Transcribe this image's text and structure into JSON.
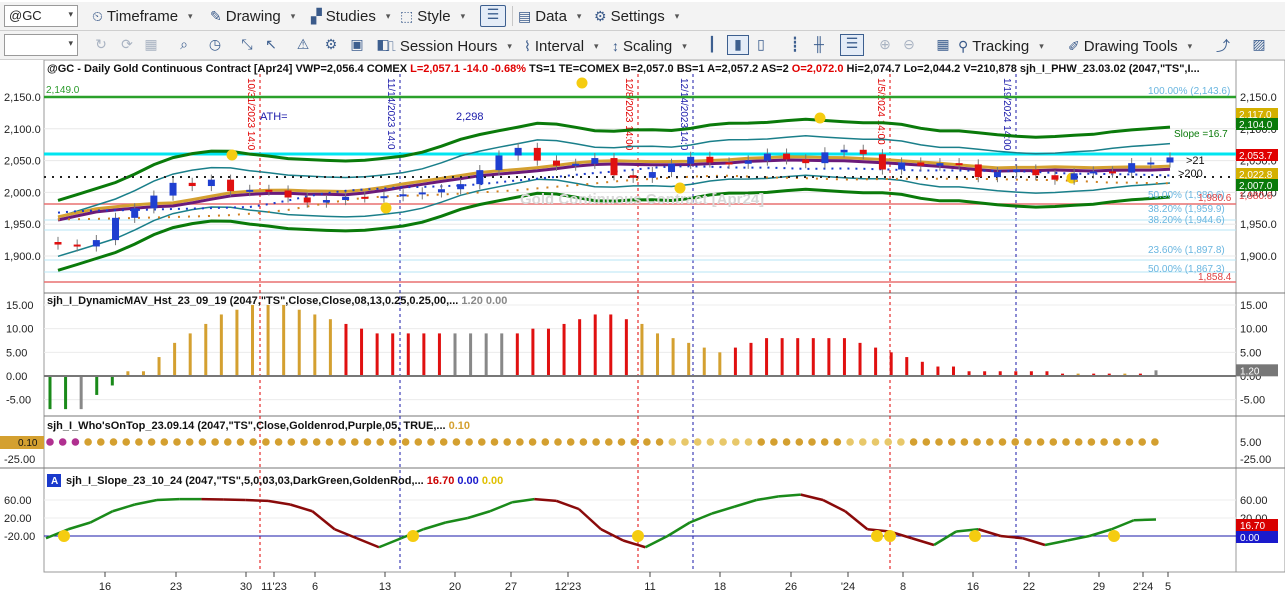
{
  "toolbar1": {
    "symbol": "@GC",
    "timeframe": "Timeframe",
    "drawing": "Drawing",
    "studies": "Studies",
    "style": "Style",
    "data": "Data",
    "settings": "Settings"
  },
  "toolbar2": {
    "session_hours": "Session Hours",
    "interval": "Interval",
    "scaling": "Scaling",
    "tracking": "Tracking",
    "drawing_tools": "Drawing Tools"
  },
  "price_panel": {
    "header": "@GC - Daily  Gold Continuous Contract [Apr24]  VWP=2,056.4  COMEX",
    "header_low": "L=2,057.1  -14.0  -0.68%",
    "header_mid": "TS=1  TE=COMEX  B=2,057.0  BS=1  A=2,057.2  AS=2",
    "header_open": "O=2,072.0",
    "header_tail": "Hi=2,074.7  Lo=2,044.2  V=210,878  sjh_I_PHW_23.03.02 (2047,\"TS\",I...",
    "watermark": "Gold Continuous Contract [Apr24]",
    "ath_label": "ATH=",
    "ath_value": "2,298",
    "line_2149": "2,149.0",
    "slope_label": "Slope =16.7",
    "lbl_21": ">21",
    "lbl_200": ">200",
    "axis_ticks": [
      "2,150.0",
      "2,100.0",
      "2,050.0",
      "2,000.0",
      "1,950.0",
      "1,900.0"
    ],
    "right_tags": [
      "2,117.0",
      "2,104.0",
      "2,053.7",
      "2,022.8",
      "2,007.0",
      "1,980.6"
    ],
    "fib_labels": [
      "100.00% (2,143.6)",
      "50.00% (1,980.6)",
      "38.20% (1,959.9)",
      "38.20% (1,944.6)",
      "23.60% (1,897.8)",
      "50.00% (1,867.3)"
    ],
    "left_fib_labels": [
      "1,980.6",
      "1,858.4"
    ],
    "vline_labels": [
      "10/31/2023 14:0",
      "11/14/2023 14:0",
      "12/8/2023 14:00",
      "12/14/2023 14:0",
      "1/5/2024 14:00",
      "1/19/2024 14:00"
    ]
  },
  "panel2": {
    "title": "sjh_I_DynamicMAV_Hst_23_09_19 (2047,\"TS\",Close,Close,08,13,0.25,0.25,00,...",
    "v1": "1.20",
    "v2": "0.00",
    "axis_ticks": [
      "15.00",
      "10.00",
      "5.00",
      "0.00",
      "-5.00"
    ],
    "last_tag": "1.20"
  },
  "panel3": {
    "title": "sjh_I_Who'sOnTop_23.09.14 (2047,\"TS\",Close,Goldenrod,Purple,05,  TRUE,...",
    "v1": "0.10",
    "axis_ticks": [
      "5.00",
      "-25.00"
    ],
    "left_tag": "0.10",
    "left_axis": "-25.00"
  },
  "panel4": {
    "badge": "A",
    "title": "sjh_I_Slope_23_10_24 (2047,\"TS\",5,0,03,03,DarkGreen,GoldenRod,...",
    "v1": "16.70",
    "v2": "0.00",
    "v3": "0.00",
    "axis_ticks": [
      "60.00",
      "20.00",
      "-20.00"
    ],
    "tag1": "16.70",
    "tag2": "0.00"
  },
  "x_axis": {
    "labels": [
      "16",
      "23",
      "30",
      "11'23",
      "6",
      "13",
      "20",
      "27",
      "12'23",
      "11",
      "18",
      "26",
      "'24",
      "8",
      "16",
      "22",
      "29",
      "2'24",
      "5"
    ]
  },
  "colors": {
    "up_bar": "#1f3fd0",
    "down_bar": "#e01010",
    "green_band": "#0a7a0a",
    "teal_band": "#1a7f8a",
    "goldenrod": "#d4a030",
    "purple": "#6a1a7a",
    "cyan": "#00e5f0",
    "slope_up": "#1a8a1a",
    "slope_down": "#8a0a0a"
  },
  "chart_data": [
    {
      "type": "line",
      "series": [
        {
          "name": "",
          "values": [
            1918,
            1915,
            1925,
            1960,
            1975,
            1995,
            2015,
            2010,
            2020,
            2002,
            2004,
            2003,
            1992,
            1984,
            1988,
            1993,
            1992,
            1994,
            1997,
            2000,
            2005,
            2013,
            2035,
            2058,
            2070,
            2050,
            2042,
            2045,
            2054,
            2027,
            2023,
            2032,
            2045,
            2056,
            2047,
            2045,
            2050,
            2061,
            2052,
            2046,
            2063,
            2067,
            2060,
            2036,
            2047,
            2042,
            2046,
            2044,
            2024,
            2032,
            2036,
            2027,
            2020,
            2030,
            2033,
            2031,
            2046,
            2047,
            2055
          ]
        }
      ]
    },
    {
      "type": "bar",
      "series": [
        {
          "name": "",
          "values": [
            -7,
            -7,
            -7,
            -4,
            -2,
            1,
            1,
            4,
            7,
            9,
            11,
            13,
            14,
            15,
            15,
            15,
            14,
            13,
            12,
            11,
            10,
            9,
            9,
            9,
            9,
            9,
            9,
            9,
            9,
            9,
            9,
            10,
            10,
            11,
            12,
            13,
            13,
            12,
            11,
            9,
            8,
            7,
            6,
            5,
            6,
            7,
            8,
            8,
            8,
            8,
            8,
            8,
            7,
            6,
            5,
            4,
            3,
            2,
            2,
            1,
            1,
            1,
            1,
            1,
            1,
            0.5,
            0.5,
            0.5,
            0.5,
            0.5,
            0.5,
            1.2
          ]
        }
      ]
    },
    {
      "type": "line",
      "series": [
        {
          "name": "",
          "values": [
            -25,
            -5,
            10,
            35,
            50,
            60,
            62,
            62,
            61,
            60,
            58,
            50,
            35,
            -5,
            -25,
            -45,
            -25,
            -5,
            10,
            20,
            35,
            55,
            62,
            58,
            40,
            -5,
            -30,
            -45,
            -20,
            10,
            30,
            45,
            60,
            68,
            72,
            60,
            35,
            -5,
            -10,
            -25,
            -40,
            -10,
            -5,
            -20,
            -25,
            -40,
            -30,
            -20,
            -5,
            15,
            16.7
          ]
        }
      ]
    }
  ]
}
